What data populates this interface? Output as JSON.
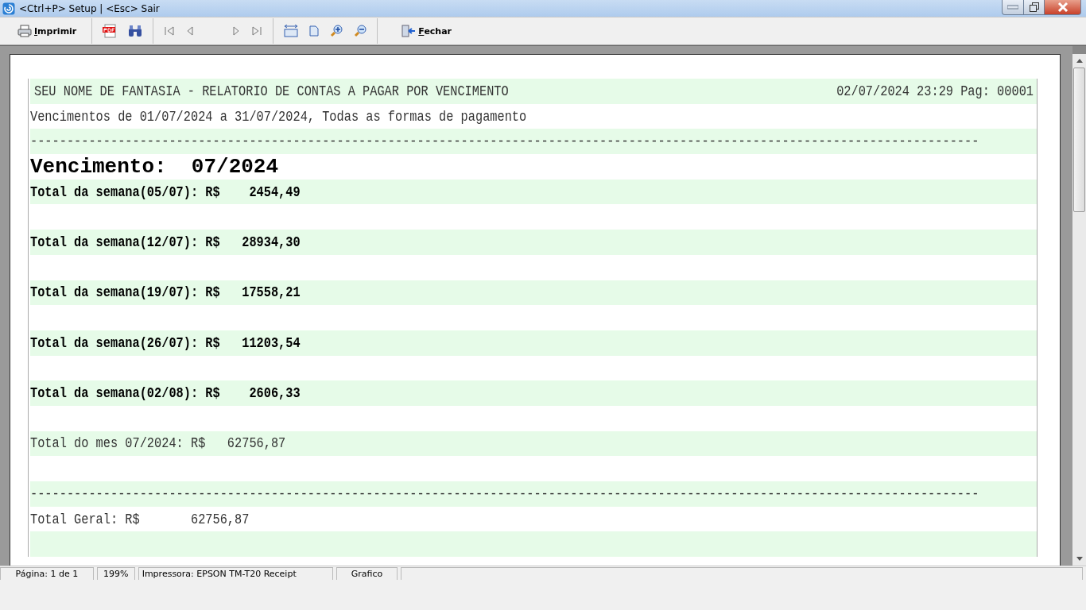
{
  "window": {
    "title": "<Ctrl+P> Setup | <Esc> Sair"
  },
  "toolbar": [
    {
      "kind": "print",
      "label": "Imprimir"
    },
    {
      "kind": "sep"
    },
    {
      "kind": "pdf"
    },
    {
      "kind": "find"
    },
    {
      "kind": "sep"
    },
    {
      "kind": "first"
    },
    {
      "kind": "prev"
    },
    {
      "kind": "gap"
    },
    {
      "kind": "next"
    },
    {
      "kind": "last"
    },
    {
      "kind": "sep"
    },
    {
      "kind": "width"
    },
    {
      "kind": "page"
    },
    {
      "kind": "zoomin"
    },
    {
      "kind": "zoomout"
    },
    {
      "kind": "sep"
    },
    {
      "kind": "close",
      "label": "Fechar"
    }
  ],
  "report": {
    "rows": [
      {
        "kind": "title",
        "text": "SEU NOME DE FANTASIA - RELATORIO DE CONTAS A PAGAR POR VENCIMENTO",
        "right": "02/07/2024 23:29 Pag: 00001"
      },
      {
        "kind": "text",
        "text": "Vencimentos de 01/07/2024 a 31/07/2024, Todas as formas de pagamento"
      },
      {
        "kind": "text",
        "text": "----------------------------------------------------------------------------------------------------------------------------------"
      },
      {
        "kind": "heading",
        "text": "Vencimento:  07/2024"
      },
      {
        "kind": "bold",
        "text": "Total da semana(05/07): R$    2454,49"
      },
      {
        "kind": "blank"
      },
      {
        "kind": "bold",
        "text": "Total da semana(12/07): R$   28934,30"
      },
      {
        "kind": "blank"
      },
      {
        "kind": "bold",
        "text": "Total da semana(19/07): R$   17558,21"
      },
      {
        "kind": "blank"
      },
      {
        "kind": "bold",
        "text": "Total da semana(26/07): R$   11203,54"
      },
      {
        "kind": "blank"
      },
      {
        "kind": "bold",
        "text": "Total da semana(02/08): R$    2606,33"
      },
      {
        "kind": "blank"
      },
      {
        "kind": "text",
        "text": "Total do mes 07/2024: R$   62756,87"
      },
      {
        "kind": "blank"
      },
      {
        "kind": "text",
        "text": "----------------------------------------------------------------------------------------------------------------------------------"
      },
      {
        "kind": "text",
        "text": "Total Geral: R$       62756,87"
      },
      {
        "kind": "blank"
      }
    ]
  },
  "status_bar": [
    "Página: 1 de 1",
    "199%",
    "Impressora: EPSON TM-T20 Receipt",
    "Grafico"
  ]
}
